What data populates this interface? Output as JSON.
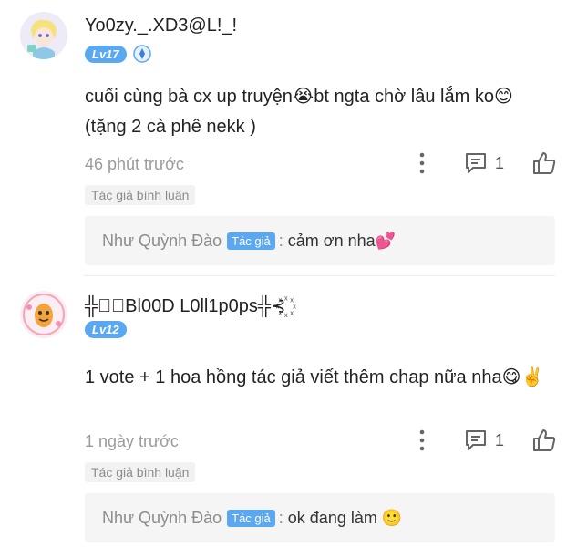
{
  "comments": [
    {
      "username": "Yo0zy._.XD3@L!_!",
      "level": "Lv17",
      "text": "cuối cùng bà cx up truyện😭bt ngta chờ lâu lắm ko😊 (tặng 2 cà phê nekk )",
      "time": "46 phút trước",
      "reply_count": "1",
      "tag": "Tác giả bình luận",
      "author_reply": {
        "name": "Như Quỳnh Đào",
        "badge": "Tác giả",
        "colon": ":",
        "text": "cảm ơn nha💕"
      }
    },
    {
      "username": "╬⊰꙰Bl00D L0ll1p0ps╬⊰꙰",
      "level": "Lv12",
      "text": "1 vote + 1 hoa hồng tác giả viết thêm chap nữa nha😋✌️",
      "time": "1 ngày trước",
      "reply_count": "1",
      "tag": "Tác giả bình luận",
      "author_reply": {
        "name": "Như Quỳnh Đào",
        "badge": "Tác giả",
        "colon": ":",
        "text": "ok đang làm 🙂"
      }
    }
  ],
  "colors": {
    "level_badge": "#5aa8f2",
    "muted_text": "#9b9b9b",
    "reply_bg": "#f5f5f5"
  },
  "icons": [
    "avatar",
    "medal-icon",
    "more-icon",
    "reply-icon",
    "like-icon"
  ]
}
